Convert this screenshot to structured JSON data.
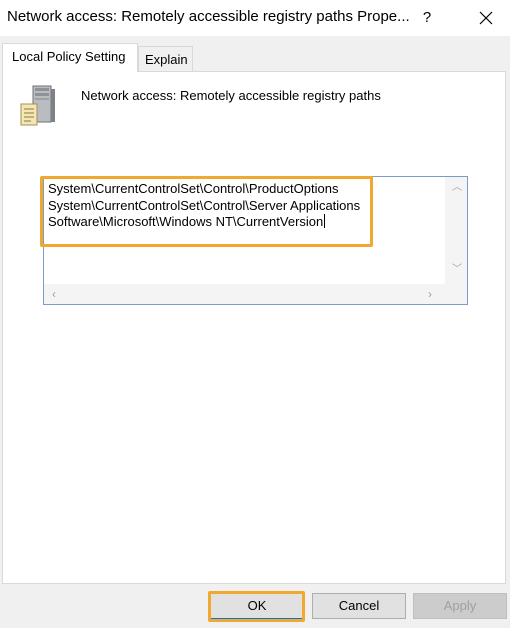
{
  "window": {
    "title": "Network access: Remotely accessible registry paths Prope...",
    "help_label": "?"
  },
  "tabs": [
    {
      "label": "Local Policy Setting",
      "active": true
    },
    {
      "label": "Explain",
      "active": false
    }
  ],
  "policy": {
    "icon": "server-policy-icon",
    "name": "Network access: Remotely accessible registry paths"
  },
  "registry_paths": [
    "System\\CurrentControlSet\\Control\\ProductOptions",
    "System\\CurrentControlSet\\Control\\Server Applications",
    "Software\\Microsoft\\Windows NT\\CurrentVersion"
  ],
  "buttons": {
    "ok": "OK",
    "cancel": "Cancel",
    "apply": "Apply"
  },
  "colors": {
    "highlight": "#f0a830",
    "edit_border": "#7a9cc6"
  }
}
